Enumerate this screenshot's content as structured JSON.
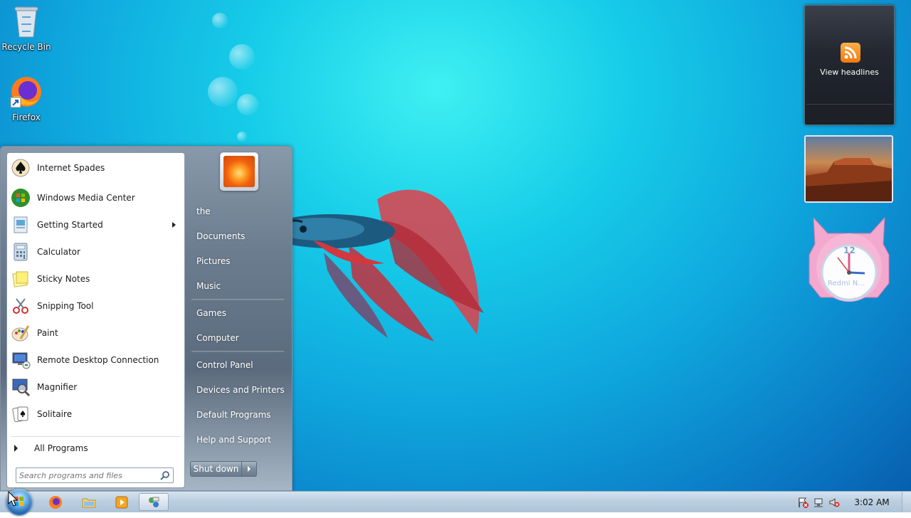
{
  "desktop": {
    "icons": [
      {
        "label": "Recycle Bin",
        "icon": "recycle-bin-icon"
      },
      {
        "label": "Firefox",
        "icon": "firefox-icon"
      }
    ]
  },
  "gadgets": {
    "feed_headlines": {
      "label": "View headlines",
      "icon": "rss-icon"
    },
    "slideshow": {
      "icon": "landscape-photo"
    },
    "clock": {
      "label": "Redmi N...",
      "numeral": "12"
    }
  },
  "start_menu": {
    "programs": [
      {
        "label": "Internet Spades",
        "icon": "spades-icon",
        "has_submenu": false
      },
      {
        "label": "Windows Media Center",
        "icon": "media-center-icon",
        "has_submenu": false
      },
      {
        "label": "Getting Started",
        "icon": "getting-started-icon",
        "has_submenu": true
      },
      {
        "label": "Calculator",
        "icon": "calculator-icon",
        "has_submenu": false
      },
      {
        "label": "Sticky Notes",
        "icon": "sticky-notes-icon",
        "has_submenu": false
      },
      {
        "label": "Snipping Tool",
        "icon": "scissors-icon",
        "has_submenu": false
      },
      {
        "label": "Paint",
        "icon": "paint-icon",
        "has_submenu": false
      },
      {
        "label": "Remote Desktop Connection",
        "icon": "remote-desktop-icon",
        "has_submenu": false
      },
      {
        "label": "Magnifier",
        "icon": "magnifier-icon",
        "has_submenu": false
      },
      {
        "label": "Solitaire",
        "icon": "solitaire-icon",
        "has_submenu": false
      }
    ],
    "all_programs": "All Programs",
    "search_placeholder": "Search programs and files",
    "right_items": [
      {
        "label": "the"
      },
      {
        "label": "Documents"
      },
      {
        "label": "Pictures"
      },
      {
        "label": "Music"
      },
      {
        "label": "Games"
      },
      {
        "label": "Computer"
      },
      {
        "label": "Control Panel"
      },
      {
        "label": "Devices and Printers"
      },
      {
        "label": "Default Programs"
      },
      {
        "label": "Help and Support"
      }
    ],
    "shutdown_label": "Shut down"
  },
  "taskbar": {
    "pinned": [
      {
        "name": "firefox",
        "icon": "firefox-icon"
      },
      {
        "name": "windows-explorer",
        "icon": "folder-icon"
      },
      {
        "name": "windows-media-player",
        "icon": "media-player-icon"
      },
      {
        "name": "control-panel",
        "icon": "control-panel-icon",
        "active": true
      }
    ],
    "tray_icons": [
      "action-center-flag-icon",
      "network-icon",
      "volume-muted-icon"
    ],
    "clock": "3:02 AM"
  },
  "colors": {
    "accent": "#1e5fa8",
    "desktop_top": "#3ff0f2",
    "desktop_bottom": "#075fae",
    "error_red": "#d8262b"
  }
}
